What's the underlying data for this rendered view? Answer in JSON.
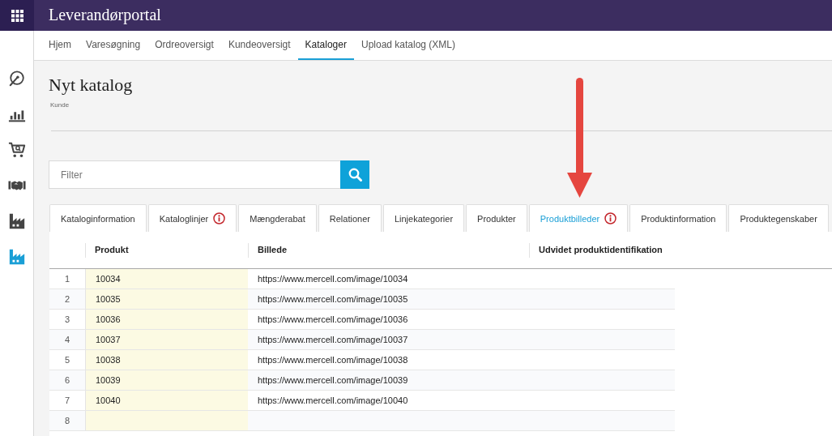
{
  "app_bar": {
    "title": "Leverandørportal"
  },
  "sidebar": {
    "items": [
      {
        "selected": false
      },
      {
        "selected": false
      },
      {
        "selected": false
      },
      {
        "selected": false
      },
      {
        "selected": false
      },
      {
        "selected": true
      }
    ]
  },
  "nav": {
    "items": [
      {
        "label": "Hjem",
        "selected": false
      },
      {
        "label": "Varesøgning",
        "selected": false
      },
      {
        "label": "Ordreoversigt",
        "selected": false
      },
      {
        "label": "Kundeoversigt",
        "selected": false
      },
      {
        "label": "Kataloger",
        "selected": true
      },
      {
        "label": "Upload katalog (XML)",
        "selected": false
      }
    ]
  },
  "page": {
    "title": "Nyt katalog",
    "subtitle": "Kunde"
  },
  "filter": {
    "placeholder": "Filter"
  },
  "tabs": [
    {
      "label": "Kataloginformation",
      "selected": false,
      "info": false
    },
    {
      "label": "Kataloglinjer",
      "selected": false,
      "info": true
    },
    {
      "label": "Mængderabat",
      "selected": false,
      "info": false
    },
    {
      "label": "Relationer",
      "selected": false,
      "info": false
    },
    {
      "label": "Linjekategorier",
      "selected": false,
      "info": false
    },
    {
      "label": "Produkter",
      "selected": false,
      "info": false
    },
    {
      "label": "Produktbilleder",
      "selected": true,
      "info": true
    },
    {
      "label": "Produktinformation",
      "selected": false,
      "info": false
    },
    {
      "label": "Produktegenskaber",
      "selected": false,
      "info": false
    }
  ],
  "table": {
    "columns": [
      {
        "label": "Produkt",
        "highlighted": true
      },
      {
        "label": "Billede",
        "highlighted": false
      },
      {
        "label": "Udvidet produktidentifikation",
        "highlighted": false
      }
    ],
    "rows": [
      {
        "number": "1",
        "cells": [
          "10034",
          "https://www.mercell.com/image/10034"
        ]
      },
      {
        "number": "2",
        "cells": [
          "10035",
          "https://www.mercell.com/image/10035"
        ]
      },
      {
        "number": "3",
        "cells": [
          "10036",
          "https://www.mercell.com/image/10036"
        ]
      },
      {
        "number": "4",
        "cells": [
          "10037",
          "https://www.mercell.com/image/10037"
        ]
      },
      {
        "number": "5",
        "cells": [
          "10038",
          "https://www.mercell.com/image/10038"
        ]
      },
      {
        "number": "6",
        "cells": [
          "10039",
          "https://www.mercell.com/image/10039"
        ]
      },
      {
        "number": "7",
        "cells": [
          "10040",
          "https://www.mercell.com/image/10040"
        ]
      },
      {
        "number": "8"
      }
    ]
  }
}
